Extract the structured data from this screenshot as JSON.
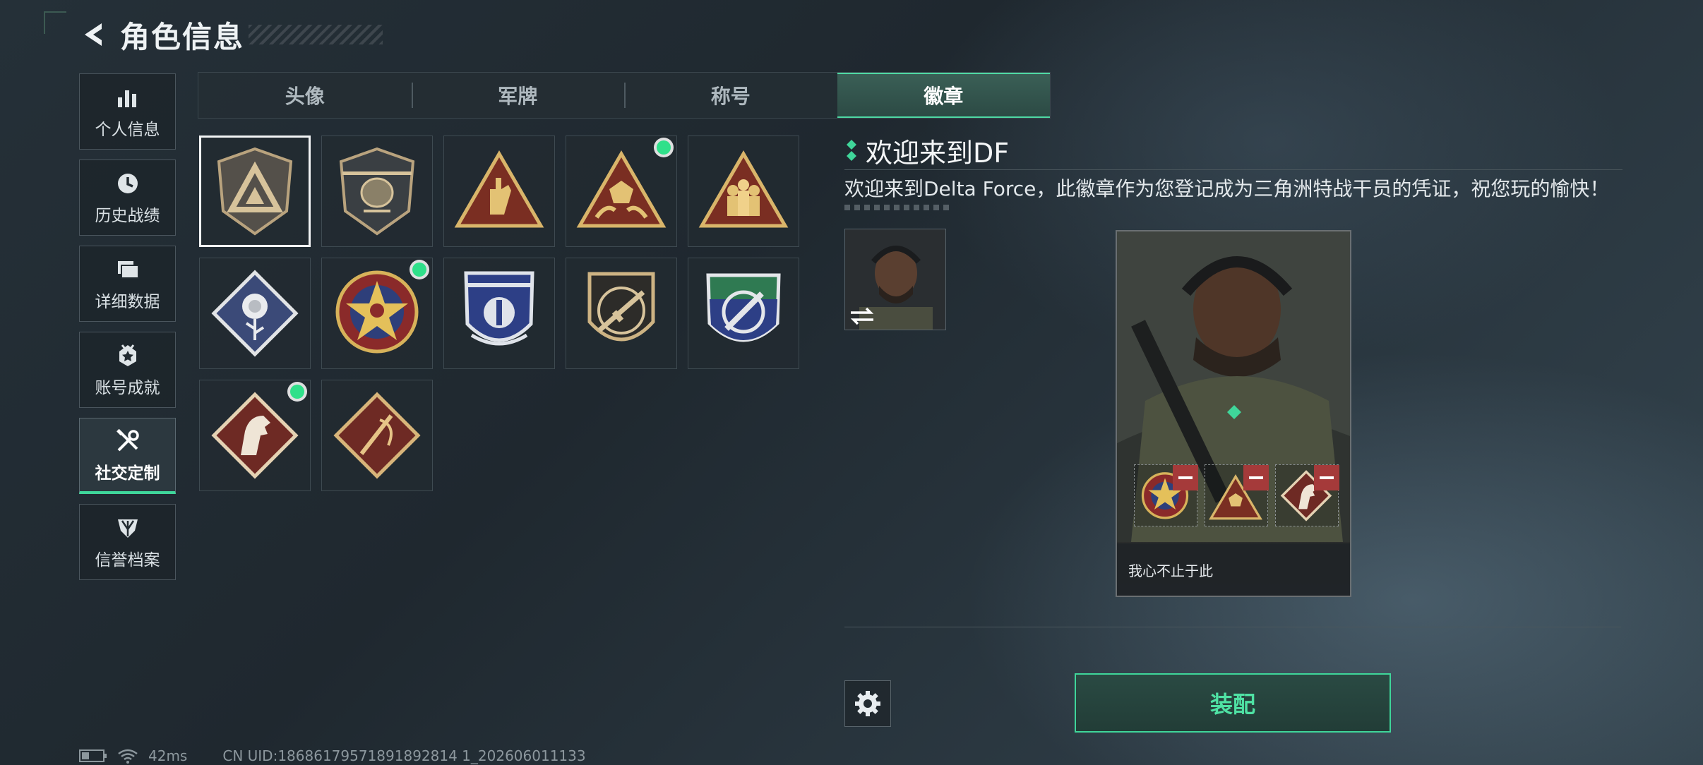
{
  "header": {
    "title": "角色信息"
  },
  "sidebar": {
    "items": [
      {
        "label": "个人信息",
        "icon": "bar-chart-icon",
        "active": false
      },
      {
        "label": "历史战绩",
        "icon": "history-clock-icon",
        "active": false
      },
      {
        "label": "详细数据",
        "icon": "folder-icon",
        "active": false
      },
      {
        "label": "账号成就",
        "icon": "achievement-icon",
        "active": false
      },
      {
        "label": "社交定制",
        "icon": "tools-icon",
        "active": true
      },
      {
        "label": "信誉档案",
        "icon": "shield-rank-icon",
        "active": false
      }
    ]
  },
  "tabs": [
    {
      "label": "头像",
      "active": false
    },
    {
      "label": "军牌",
      "active": false
    },
    {
      "label": "称号",
      "active": false
    },
    {
      "label": "徽章",
      "active": true
    }
  ],
  "badges": [
    {
      "name": "delta-triangle-badge",
      "new": false,
      "selected": true
    },
    {
      "name": "helicopter-badge",
      "new": false,
      "selected": false
    },
    {
      "name": "hand-sign-badge",
      "new": false,
      "selected": false
    },
    {
      "name": "dice-hands-badge",
      "new": true,
      "selected": false
    },
    {
      "name": "squad-badge",
      "new": false,
      "selected": false
    },
    {
      "name": "rose-badge",
      "new": false,
      "selected": false
    },
    {
      "name": "star-emblem-badge",
      "new": true,
      "selected": false
    },
    {
      "name": "wings-shield-badge",
      "new": false,
      "selected": false
    },
    {
      "name": "rifle-badge",
      "new": false,
      "selected": false
    },
    {
      "name": "knife-shield-badge",
      "new": false,
      "selected": false
    },
    {
      "name": "horse-badge",
      "new": true,
      "selected": false
    },
    {
      "name": "feather-badge",
      "new": false,
      "selected": false
    }
  ],
  "detail": {
    "title": "欢迎来到DF",
    "description": "欢迎来到Delta Force，此徽章作为您登记成为三角洲特战干员的凭证，祝您玩的愉快！",
    "card_caption": "我心不止于此"
  },
  "actions": {
    "equip_label": "装配"
  },
  "status": {
    "ping": "42ms",
    "uid": "CN UID:18686179571891892814 1_202606011133"
  },
  "colors": {
    "accent": "#3fd69a",
    "new_dot": "#2fe08a",
    "remove": "#a53a3a"
  }
}
